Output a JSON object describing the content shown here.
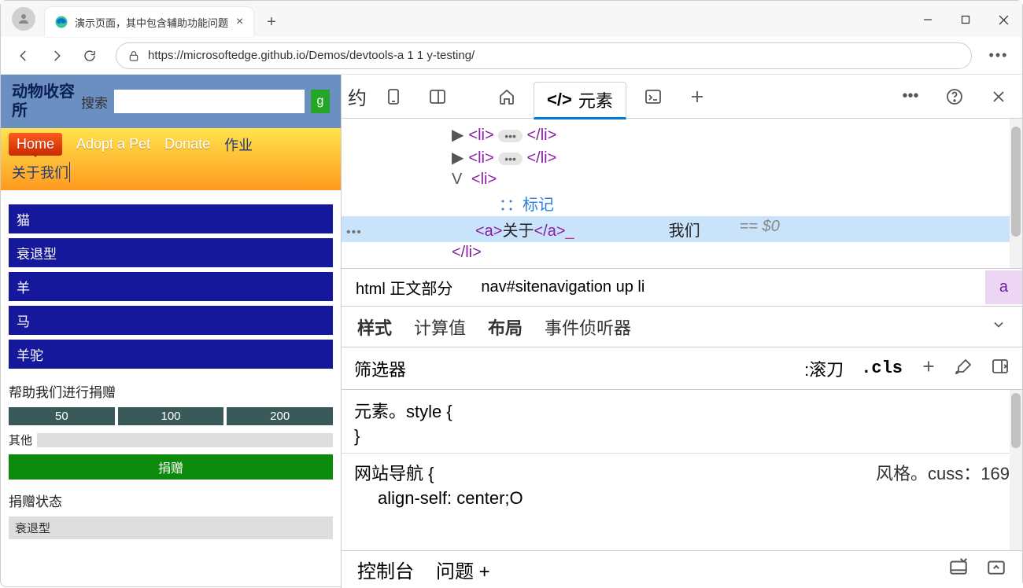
{
  "browser": {
    "tab_title": "演示页面，其中包含辅助功能问题",
    "url": "https://microsoftedge.github.io/Demos/devtools-a 1 1 y-testing/"
  },
  "page": {
    "site_title": "动物收容所",
    "search_label": "搜索",
    "search_go": "g",
    "nav": {
      "home": "Home",
      "adopt": "Adopt a Pet",
      "donate": "Donate",
      "jobs": "作业",
      "about": "关于我们"
    },
    "pets": [
      "猫",
      "衰退型",
      "羊",
      "马",
      "羊驼"
    ],
    "donate": {
      "heading": "帮助我们进行捐赠",
      "amounts": [
        "50",
        "100",
        "200"
      ],
      "other_label": "其他",
      "submit": "捐赠"
    },
    "status_heading": "捐赠状态",
    "status_item": "衰退型"
  },
  "devtools": {
    "inspect_label": "约",
    "elements_tab": "元素",
    "dom": {
      "li_open": "<li>",
      "li_close": "</li>",
      "marker": "：：标记",
      "a_open": "<a>",
      "a_text": "关于",
      "a_close": "</a>",
      "trail": "我们",
      "dollar": "== $0",
      "li_end": "</li>"
    },
    "breadcrumb": {
      "first": "html 正文部分",
      "mid": "nav#sitenavigation up li",
      "sel": "a"
    },
    "styles_tabs": {
      "styles": "样式",
      "computed": "计算值",
      "layout": "布局",
      "listeners": "事件侦听器"
    },
    "filter": {
      "label": "筛选器",
      "hov": ":滚刀",
      "cls": ".cls"
    },
    "css": {
      "l1": "元素。style {",
      "l2": "}",
      "l3": "网站导航 {",
      "l3r": "风格。cuss：169",
      "l4": "align-self: center;O"
    },
    "drawer": {
      "console": "控制台",
      "issues": "问题 +"
    }
  }
}
